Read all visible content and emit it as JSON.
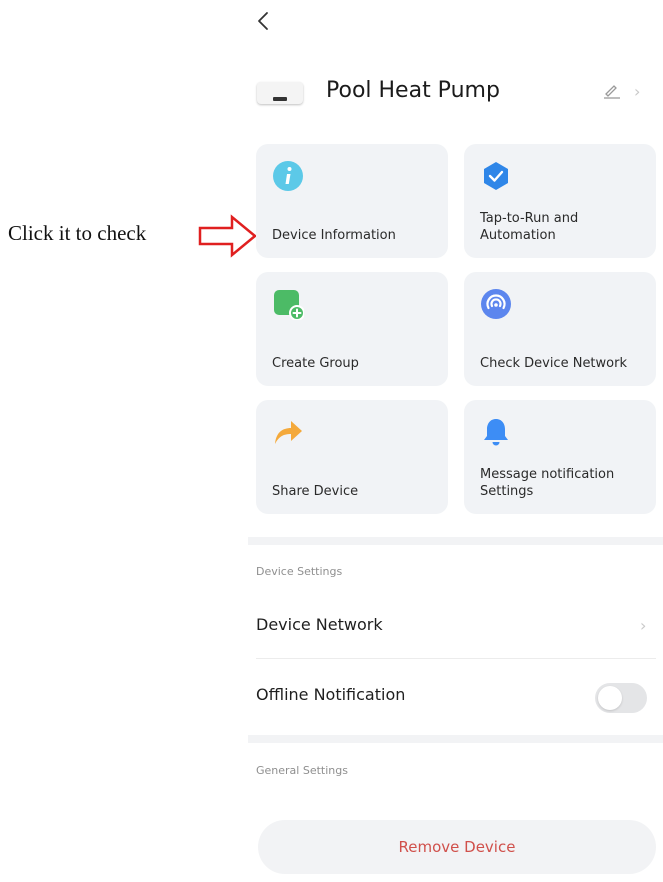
{
  "annotation": {
    "text": "Click it to check"
  },
  "header": {
    "title": "Pool Heat Pump"
  },
  "cards": [
    {
      "label": "Device Information"
    },
    {
      "label": "Tap-to-Run and Automation"
    },
    {
      "label": "Create Group"
    },
    {
      "label": "Check Device Network"
    },
    {
      "label": "Share Device"
    },
    {
      "label": "Message notification Settings"
    }
  ],
  "device_settings": {
    "title": "Device Settings",
    "network_label": "Device Network",
    "offline_label": "Offline Notification",
    "offline_enabled": false
  },
  "general_settings": {
    "title": "General Settings"
  },
  "remove_label": "Remove Device",
  "colors": {
    "card_bg": "#f1f3f6",
    "remove_text": "#d0504b",
    "annotation_arrow": "#e02020"
  }
}
